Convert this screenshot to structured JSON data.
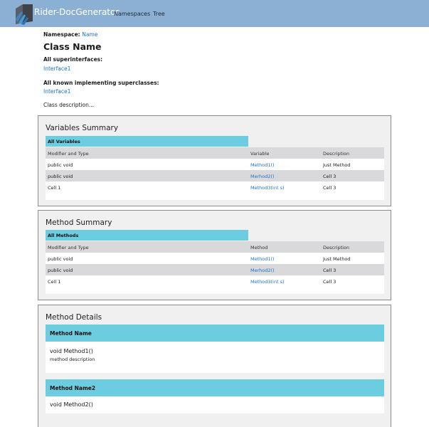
{
  "navbar": {
    "brand": "Rider-DocGenerator",
    "links": [
      "Namespaces",
      "Tree"
    ],
    "logo_icon": "rider-logo-icon"
  },
  "header": {
    "namespace_label": "Namespace:",
    "namespace_value": "Name",
    "class_name": "Class Name",
    "superinterfaces_label": "All superinterfaces:",
    "superinterfaces": [
      "Interface1"
    ],
    "superclasses_label": "All known implementing superclasses:",
    "superclasses": [
      "Interface1"
    ],
    "description": "Class description..."
  },
  "variables": {
    "title": "Variables Summary",
    "tab": "All Variables",
    "columns": [
      "Modifier and Type",
      "Variable",
      "Description"
    ],
    "rows": [
      [
        "public void",
        "Method1()",
        "Just Method"
      ],
      [
        "public void",
        "Merhod2()",
        "Cell 3"
      ],
      [
        "Cell 1",
        "Method3(int s)",
        "Cell 3"
      ]
    ]
  },
  "methods": {
    "title": "Method Summary",
    "tab": "All Methods",
    "columns": [
      "Modifier and Type",
      "Method",
      "Description"
    ],
    "rows": [
      [
        "public void",
        "Method1()",
        "Just Method"
      ],
      [
        "public void",
        "Merhod2()",
        "Cell 3"
      ],
      [
        "Cell 1",
        "Method3(int s)",
        "Cell 3"
      ]
    ]
  },
  "details": {
    "title": "Method Details",
    "items": [
      {
        "name": "Method Name",
        "signature": "void Method1()",
        "description": "method description"
      },
      {
        "name": "Method Name2",
        "signature": "void Method2()",
        "description": ""
      }
    ]
  },
  "colors": {
    "navbar": "#8bb0d3",
    "accent": "#6ccce0",
    "link": "#1a73c9"
  }
}
